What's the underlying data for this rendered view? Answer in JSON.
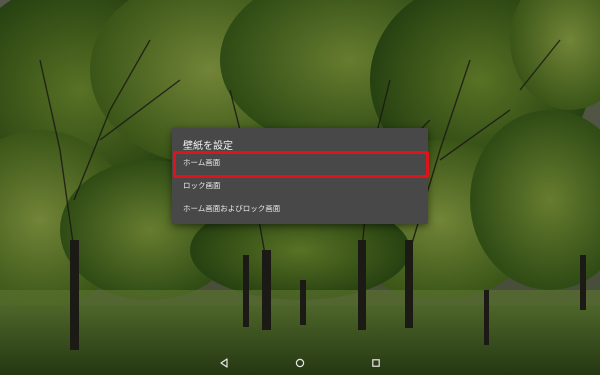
{
  "dialog": {
    "title": "壁紙を設定",
    "options": [
      {
        "label": "ホーム画面"
      },
      {
        "label": "ロック画面"
      },
      {
        "label": "ホーム画面およびロック画面"
      }
    ],
    "highlight_color": "#e0131a"
  },
  "navbar": {
    "icons": [
      "back-icon",
      "home-icon",
      "recent-apps-icon"
    ]
  },
  "wallpaper": {
    "subject": "forest-trees"
  }
}
